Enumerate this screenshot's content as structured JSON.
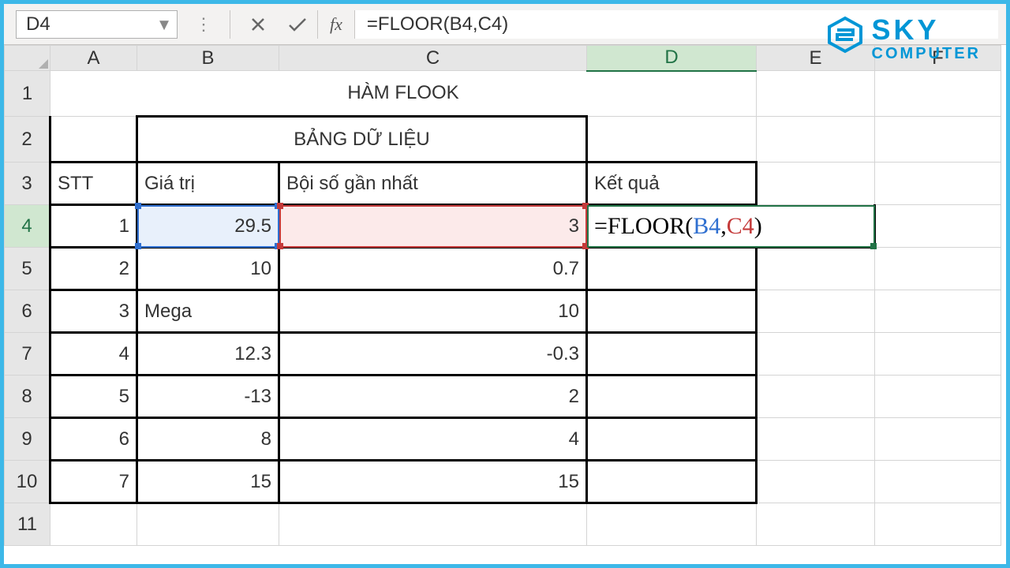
{
  "formula_bar": {
    "name_box": "D4",
    "fx_label": "fx",
    "formula": "=FLOOR(B4,C4)"
  },
  "logo": {
    "sky": "SKY",
    "computer": "COMPUTER"
  },
  "columns": [
    "A",
    "B",
    "C",
    "D",
    "E",
    "F"
  ],
  "active_col": "D",
  "active_row": "4",
  "rows": [
    "1",
    "2",
    "3",
    "4",
    "5",
    "6",
    "7",
    "8",
    "9",
    "10",
    "11"
  ],
  "title": "HÀM FLOOK",
  "subtitle": "BẢNG DỮ LIỆU",
  "headers": {
    "stt": "STT",
    "giatri": "Giá trị",
    "boiso": "Bội số gần nhất",
    "ketqua": "Kết quả"
  },
  "table": [
    {
      "stt": "1",
      "giatri": "29.5",
      "boiso": "3",
      "ketqua_formula": {
        "eq": "=FLOOR(",
        "r1": "B4",
        "comma": ",",
        "r2": "C4",
        "close": ")"
      }
    },
    {
      "stt": "2",
      "giatri": "10",
      "boiso": "0.7",
      "ketqua": ""
    },
    {
      "stt": "3",
      "giatri": "Mega",
      "giatri_align": "left",
      "boiso": "10",
      "ketqua": ""
    },
    {
      "stt": "4",
      "giatri": "12.3",
      "boiso": "-0.3",
      "ketqua": ""
    },
    {
      "stt": "5",
      "giatri": "-13",
      "boiso": "2",
      "ketqua": ""
    },
    {
      "stt": "6",
      "giatri": "8",
      "boiso": "4",
      "ketqua": ""
    },
    {
      "stt": "7",
      "giatri": "15",
      "boiso": "15",
      "ketqua": ""
    }
  ]
}
